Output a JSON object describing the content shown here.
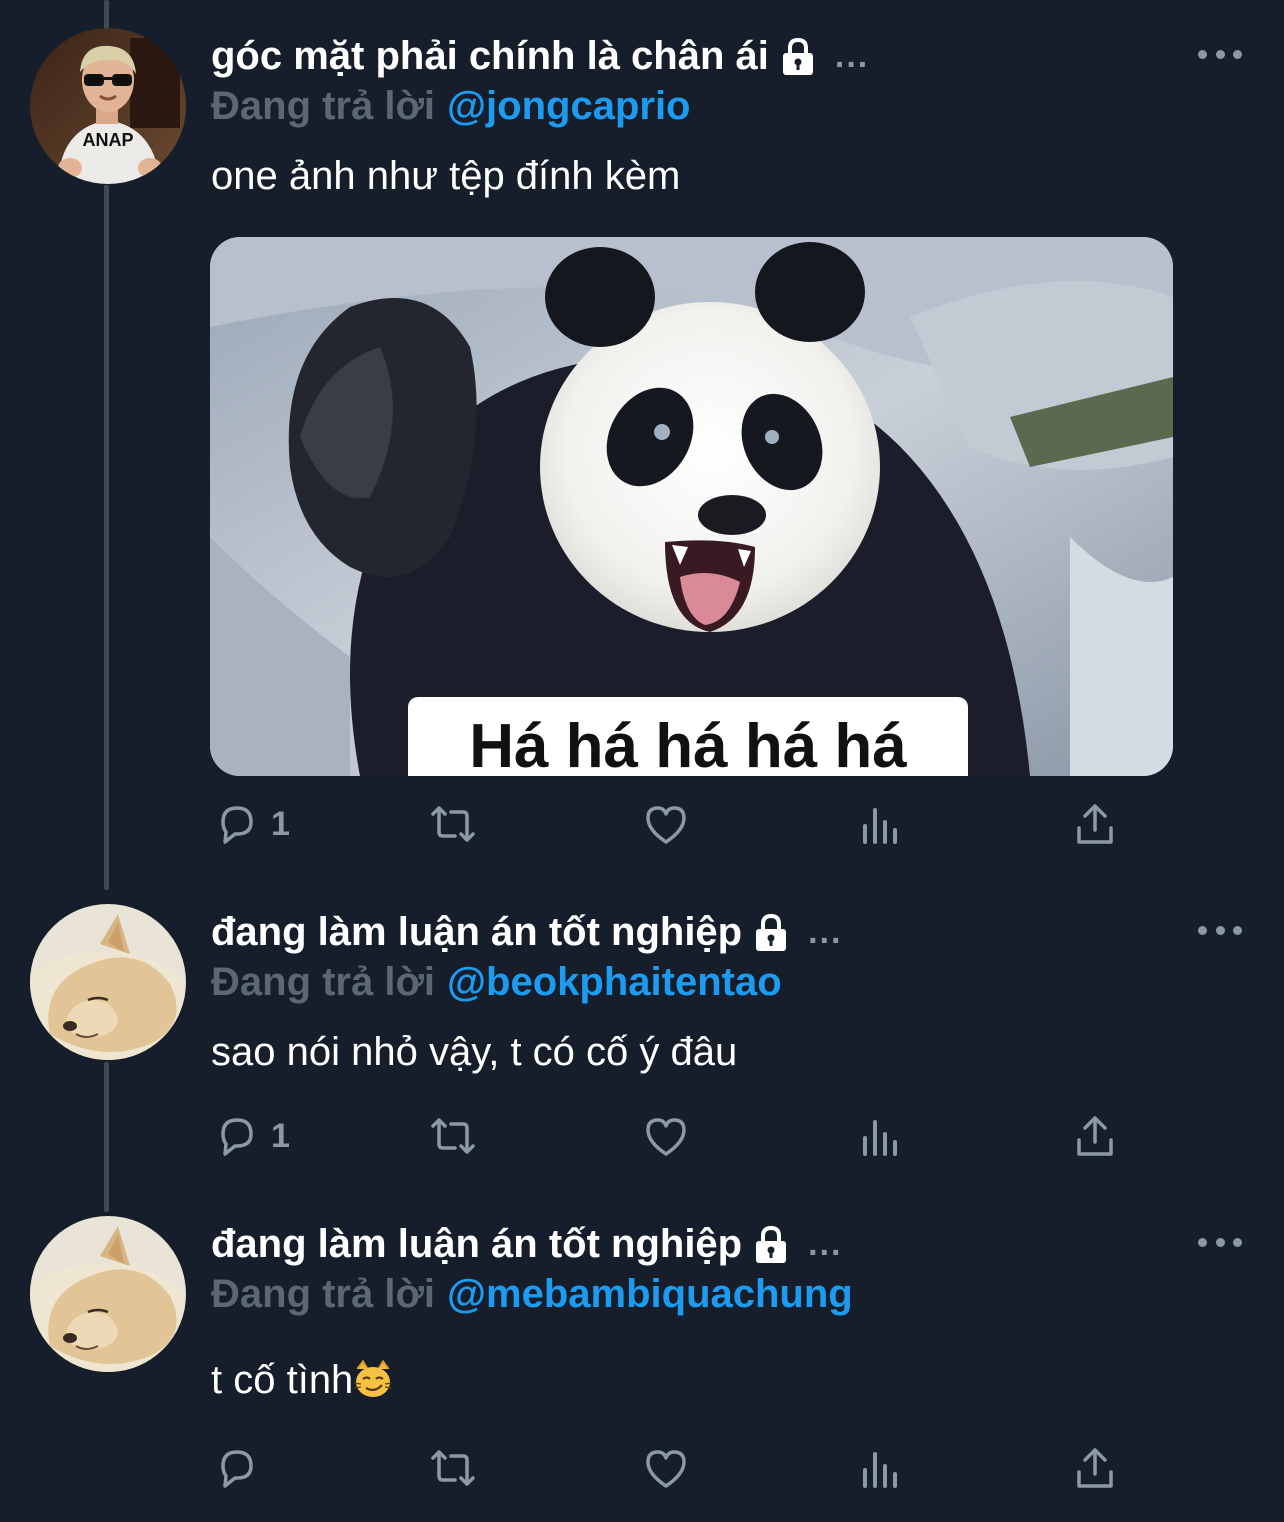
{
  "tweets": [
    {
      "display_name": "góc mặt phải chính là chân ái",
      "ellipsis": "...",
      "reply_prefix": "Đang trả lời",
      "reply_handle": "@jongcaprio",
      "text": "one ảnh như tệp đính kèm",
      "avatar": "boy-sunglasses-avatar",
      "media": {
        "caption": "Há há há há há",
        "subject": "laughing-panda"
      },
      "reply_count": "1"
    },
    {
      "display_name": "đang làm luận án tốt nghiệp",
      "ellipsis": "...",
      "reply_prefix": "Đang trả lời",
      "reply_handle": "@beokphaitentao",
      "text": "sao nói nhỏ vậy, t có cố ý đâu",
      "avatar": "sleeping-dog-avatar",
      "reply_count": "1"
    },
    {
      "display_name": "đang làm luận án tốt nghiệp",
      "ellipsis": "...",
      "reply_prefix": "Đang trả lời",
      "reply_handle": "@mebambiquachung",
      "text": "t cố tình",
      "text_emoji": "smirking-cat-emoji",
      "avatar": "sleeping-dog-avatar",
      "reply_count": ""
    }
  ],
  "icons": {
    "lock": "lock-icon",
    "more": "more-icon",
    "reply": "reply-icon",
    "retweet": "retweet-icon",
    "like": "heart-icon",
    "analytics": "analytics-icon",
    "share": "share-icon"
  },
  "colors": {
    "background": "#151e2a",
    "text_primary": "#ffffff",
    "text_secondary": "#8b98a5",
    "reply_prefix": "#5b6773",
    "link": "#1d9bf0",
    "thread_line": "#3e4955"
  }
}
